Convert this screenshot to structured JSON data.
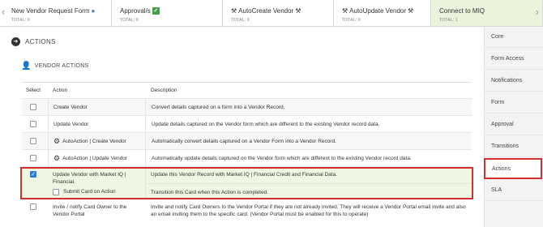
{
  "stages": [
    {
      "title": "New Vendor Request Form",
      "icon": "globe-icon",
      "total": "TOTAL: 0"
    },
    {
      "title": "Approval/s",
      "icon": "check-badge-icon",
      "total": "TOTAL: 0"
    },
    {
      "title": "AutoCreate Vendor",
      "icon": "tools-icon",
      "total": "TOTAL: 0"
    },
    {
      "title": "AutoUpdate Vendor",
      "icon": "tools-icon",
      "total": "TOTAL: 0"
    },
    {
      "title": "Connect to MIQ",
      "icon": "",
      "total": "TOTAL: 1"
    }
  ],
  "section": {
    "title": "ACTIONS",
    "subtitle": "VENDOR ACTIONS"
  },
  "table": {
    "headers": {
      "select": "Select",
      "action": "Action",
      "description": "Description"
    },
    "rows": [
      {
        "action": "Create Vendor",
        "description": "Convert details captured on a form into a Vendor Record.",
        "checked": false
      },
      {
        "action": "Update Vendor",
        "description": "Update details captured on the Vendor form which are different to the existing Vendor record data.",
        "checked": false
      },
      {
        "action": "AutoAction | Create Vendor",
        "description": "Automatically convert details captured on a Vendor Form into a Vendor Record.",
        "checked": false
      },
      {
        "action": "AutoAction | Update Vendor",
        "description": "Automatically update details captured on the Vendor form which are different to the existing Vendor record data.",
        "checked": false
      },
      {
        "action": "Update Vendor with Market IQ | Financial.",
        "description": "Update this Vendor Record with Market IQ | Financial Credit and Financial Data.",
        "checked": true,
        "sub_label": "Submit Card on Action",
        "sub_description": "Transition this Card when this Action is completed."
      },
      {
        "action": "Invite / notify Card Owner to the Vendor Portal",
        "description": "Invite and notify Card Owners to the Vendor Portal if they are not already invited. They will receive a Vendor Portal email invite and also an email inviting them to the specific card. (Vendor Portal must be enabled for this to operate)",
        "checked": false
      }
    ]
  },
  "sidebar": {
    "items": [
      "Core",
      "Form Access",
      "Notifications",
      "Form",
      "Approval",
      "Transitions",
      "Actions",
      "SLA"
    ],
    "active": "Actions"
  },
  "colors": {
    "highlight_border": "#d32f2f",
    "active_stage_bg": "#eaf4dc",
    "checkbox_checked": "#2f7dd4"
  }
}
